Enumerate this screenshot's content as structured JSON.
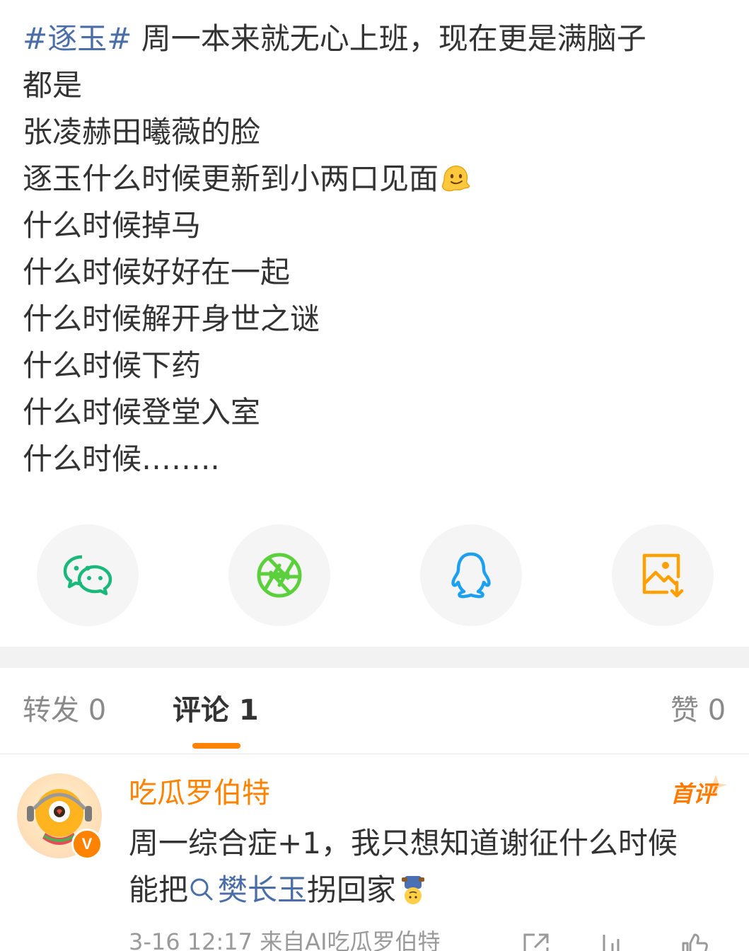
{
  "post": {
    "hashtag": "#逐玉#",
    "lines": [
      " 周一本来就无心上班，现在更是满脑子",
      "都是",
      "张凌赫田曦薇的脸",
      "逐玉什么时候更新到小两口见面",
      "什么时候掉马",
      "什么时候好好在一起",
      "什么时候解开身世之谜",
      "什么时候下药",
      "什么时候登堂入室",
      "什么时候…….."
    ],
    "emoji": "melting-face"
  },
  "share": {
    "buttons": [
      {
        "name": "wechat",
        "icon": "wechat-icon",
        "color": "#1aad19"
      },
      {
        "name": "moments",
        "icon": "moments-aperture-icon",
        "color": "#5ccf3c"
      },
      {
        "name": "qq",
        "icon": "qq-penguin-icon",
        "color": "#1ea0f0"
      },
      {
        "name": "save-image",
        "icon": "save-image-icon",
        "color": "#ffa000"
      }
    ]
  },
  "tabs": {
    "repost": "转发 0",
    "comments": "评论 1",
    "likes": "赞 0",
    "active": "comments",
    "accent": "#ff8200"
  },
  "comment": {
    "username": "吃瓜罗伯特",
    "badge": "首评",
    "verified_mark": "V",
    "line1": "周一综合症+1，我只想知道谢征什么时候",
    "line2_prefix": "能把",
    "topic": "樊长玉",
    "line2_suffix": "拐回家",
    "meta": "3-16 12:17 来自AI吃瓜罗伯特"
  },
  "colors": {
    "text": "#333333",
    "link": "#4b6ea8",
    "orange": "#ff8200",
    "muted": "#8a8a8a"
  }
}
